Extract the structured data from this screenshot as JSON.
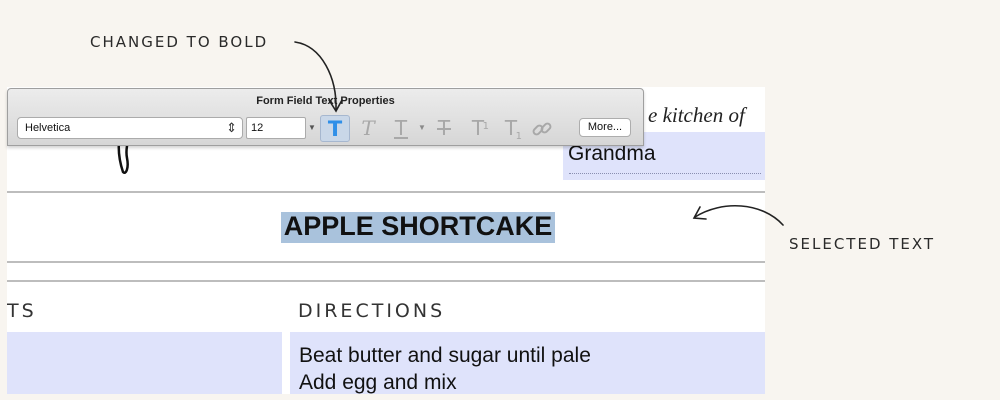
{
  "panel": {
    "title": "Form Field Text Properties",
    "font_value": "Helvetica",
    "size_value": "12",
    "more_label": "More...",
    "style_buttons": [
      {
        "name": "bold",
        "active": true
      },
      {
        "name": "italic",
        "active": false
      },
      {
        "name": "underline",
        "active": false
      },
      {
        "name": "strikethrough",
        "active": false
      },
      {
        "name": "superscript",
        "active": false
      },
      {
        "name": "subscript",
        "active": false
      },
      {
        "name": "link",
        "active": false
      }
    ]
  },
  "document": {
    "kitchen_text": "e kitchen of",
    "grandma_value": "Grandma",
    "recipe_title": "APPLE SHORTCAKE",
    "ingredients_heading": "TS",
    "directions_heading": "DIRECTIONS",
    "directions_lines": [
      "Beat butter and sugar until pale",
      "Add egg and mix"
    ]
  },
  "callouts": {
    "changed_to_bold": "CHANGED TO BOLD",
    "selected_text": "SELECTED TEXT"
  },
  "colors": {
    "field_highlight": "#dfe3fb",
    "selection": "#a9c2dc",
    "bold_active": "#2f8fe8",
    "page_background": "#f8f5f0"
  }
}
